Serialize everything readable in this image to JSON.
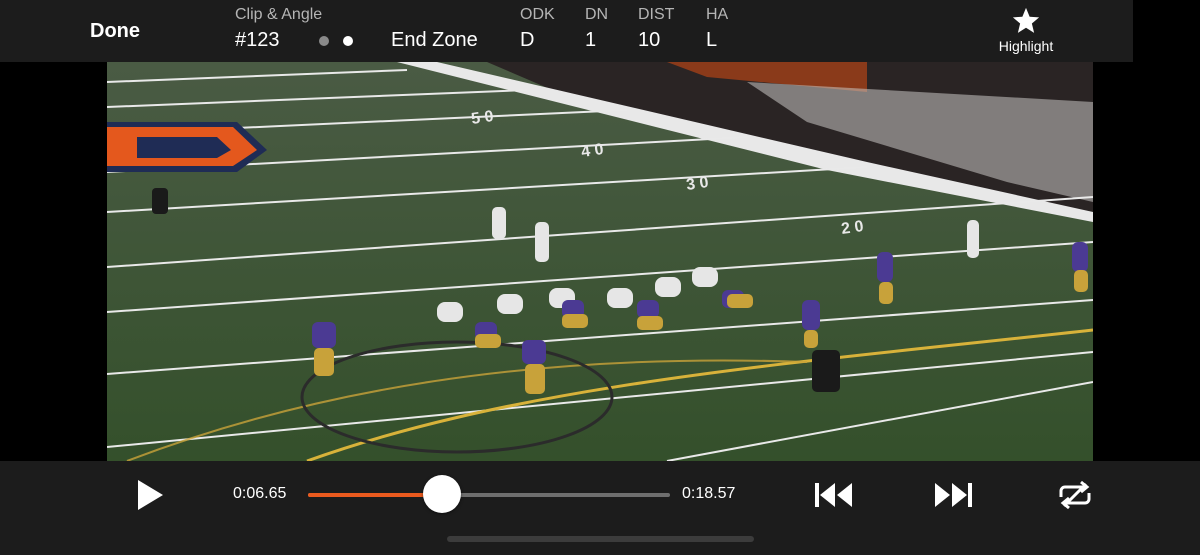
{
  "header": {
    "done_label": "Done",
    "clip_angle_label": "Clip & Angle",
    "clip_number": "#123",
    "angle_name": "End Zone",
    "angle_dots": [
      {
        "active": false
      },
      {
        "active": true
      }
    ],
    "fields": [
      {
        "label": "ODK",
        "value": "D"
      },
      {
        "label": "DN",
        "value": "1"
      },
      {
        "label": "DIST",
        "value": "10"
      },
      {
        "label": "HA",
        "value": "L"
      }
    ],
    "highlight_label": "Highlight",
    "highlight_icon": "star-icon"
  },
  "video": {
    "description_icon": "football-field-video-frame",
    "colors": {
      "field": "#3a5530",
      "endzone": "#e4581d",
      "crowd": "#d8d8d8"
    }
  },
  "playback": {
    "play_icon": "play-icon",
    "current_time": "0:06.65",
    "total_time": "0:18.57",
    "progress_fraction": 0.3713,
    "accent_color": "#ea5a1e",
    "skip_back_icon": "skip-back-icon",
    "skip_forward_icon": "skip-forward-icon",
    "loop_icon": "loop-off-icon"
  }
}
